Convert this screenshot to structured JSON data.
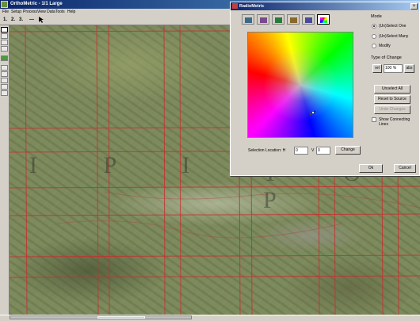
{
  "app": {
    "title": "OrthoMetric - 1/1 Large",
    "menu": [
      "File",
      "Setup",
      "Process",
      "View Data",
      "Tools",
      "Help"
    ],
    "toolbar": {
      "btn1": "1.",
      "btn2": "2.",
      "btn3": "3.",
      "sep": "—"
    }
  },
  "map": {
    "watermark_top": "I P I O",
    "watermark_right": "T O P"
  },
  "dialog": {
    "title": "RadioMetric",
    "close_glyph": "×",
    "tabs": [
      {
        "icon": "image-tab-icon",
        "color": "#3a6a8a"
      },
      {
        "icon": "image-tab-icon",
        "color": "#7a4a8a"
      },
      {
        "icon": "image-tab-icon",
        "color": "#2a7a3a"
      },
      {
        "icon": "image-tab-icon",
        "color": "#8a6a2a"
      },
      {
        "icon": "image-tab-icon",
        "color": "#4a4a9a"
      },
      {
        "icon": "color-wheel-tab-icon",
        "color": "#d04080"
      }
    ],
    "selection_label": "Selection Location: H",
    "h_value": "0",
    "v_label": "V",
    "v_value": "0",
    "change_label": "Change",
    "mode": {
      "label": "Mode",
      "options": [
        {
          "label": "(Un)Select One",
          "selected": true
        },
        {
          "label": "(Un)Select Many",
          "selected": false
        },
        {
          "label": "Modify",
          "selected": false
        }
      ]
    },
    "type_of_change": {
      "label": "Type of Change",
      "rel_label": "rel",
      "value": "100 %",
      "abs_label": "abs"
    },
    "buttons": {
      "unselect_all": "Unselect All",
      "reset_to_source": "Reset to Source",
      "undo_changes": "Undo Changes",
      "ok": "Ok",
      "cancel": "Cancel"
    },
    "show_connecting_lines": "Show Connecting Lines"
  }
}
